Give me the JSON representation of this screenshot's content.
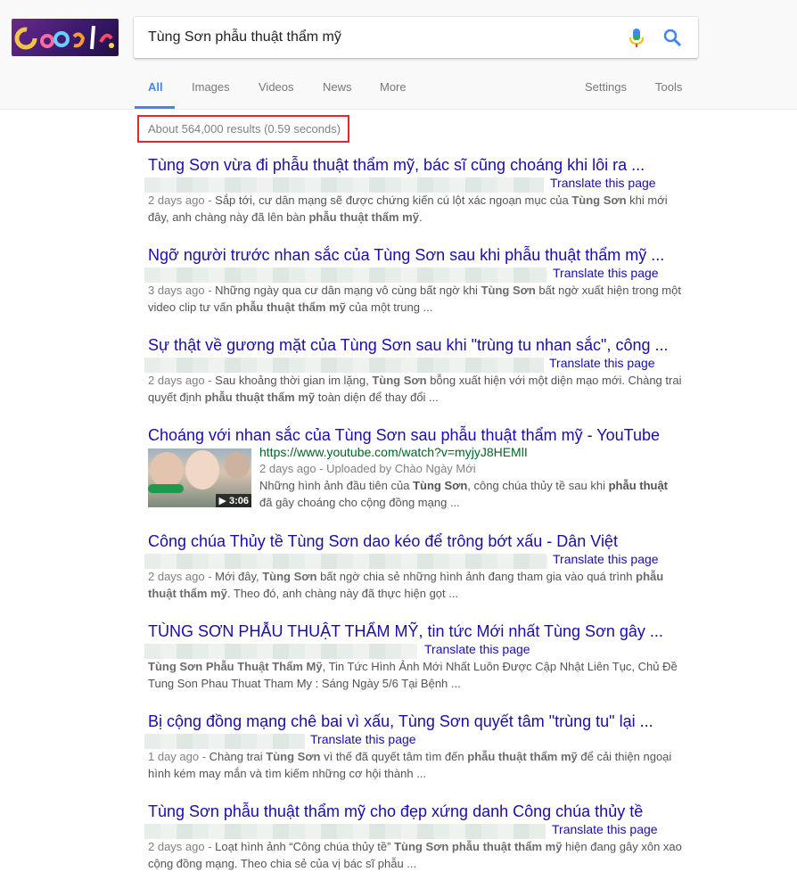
{
  "search": {
    "query": "Tùng Sơn phẫu thuật thẩm mỹ"
  },
  "logo": {
    "alt": "Google doodle logo"
  },
  "tabs": [
    {
      "label": "All",
      "active": true
    },
    {
      "label": "Images"
    },
    {
      "label": "Videos"
    },
    {
      "label": "News"
    },
    {
      "label": "More"
    }
  ],
  "right_tabs": [
    {
      "label": "Settings"
    },
    {
      "label": "Tools"
    }
  ],
  "stats": "About 564,000 results (0.59 seconds)",
  "results": [
    {
      "title": "Tùng Sơn vừa đi phẫu thuật thẩm mỹ, bác sĩ cũng choáng khi lôi ra ...",
      "translate": "Translate this page",
      "date": "2 days ago - ",
      "snippet_html": "Sắp tới, cư dân mạng sẽ được chứng kiến cú lột xác ngoạn mục của <b>Tùng Sơn</b> khi mới đây, anh chàng này đã lên bàn <b>phẫu thuật thẩm mỹ</b>."
    },
    {
      "title": "Ngỡ người trước nhan sắc của Tùng Sơn sau khi phẫu thuật thẩm mỹ ...",
      "translate": "Translate this page",
      "date": "3 days ago - ",
      "snippet_html": "Những ngày qua cư dân mạng vô cùng bất ngờ khi <b>Tùng Sơn</b> bất ngờ xuất hiện trong một video clip tư vấn <b>phẫu thuật thẩm mỹ</b> của một trung ..."
    },
    {
      "title": "Sự thật về gương mặt của Tùng Sơn sau khi \"trùng tu nhan sắc\", công ...",
      "translate": "Translate this page",
      "date": "2 days ago - ",
      "snippet_html": "Sau khoảng thời gian im lặng, <b>Tùng Sơn</b> bỗng xuất hiện với một diện mạo mới. Chàng trai quyết định <b>phẫu thuật thẩm mỹ</b> toàn diện để thay đổi ..."
    },
    {
      "title": "Choáng với nhan sắc của Tùng Sơn sau phẫu thuật thẩm mỹ - YouTube",
      "url": "https://www.youtube.com/watch?v=myjyJ8HEMlI",
      "date": "2 days ago - Uploaded by Chào Ngày Mới",
      "snippet_html": "Những hình ảnh đầu tiên của <b>Tùng Sơn</b>, công chúa thủy tề sau khi <b>phẫu thuật</b> đã gây choáng cho cộng đồng mạng ...",
      "duration": "▶ 3:06"
    },
    {
      "title": "Công chúa Thủy tề Tùng Sơn dao kéo để trông bớt xấu - Dân Việt",
      "translate": "Translate this page",
      "date": "2 days ago - ",
      "snippet_html": "Mới đây, <b>Tùng Sơn</b> bất ngờ chia sẻ những hình ảnh đang tham gia vào quá trình <b>phẫu thuật thẩm mỹ</b>. Theo đó, anh chàng này đã thực hiện gọt ..."
    },
    {
      "title": "TÙNG SƠN PHẪU THUẬT THẨM MỸ, tin tức Mới nhất Tùng Sơn gây ...",
      "translate": "Translate this page",
      "date": "",
      "snippet_html": "<b>Tùng Sơn Phẫu Thuật Thẩm Mỹ</b>, Tin Tức Hình Ảnh Mới Nhất Luôn Được Cập Nhật Liên Tục, Chủ Đề Tung Son Phau Thuat Tham My : Sáng Ngày 5/6 Tại Bệnh ..."
    },
    {
      "title": "Bị cộng đồng mạng chê bai vì xấu, Tùng Sơn quyết tâm \"trùng tu\" lại ...",
      "translate": "Translate this page",
      "date": "1 day ago - ",
      "snippet_html": "Chàng trai <b>Tùng Sơn</b> vì thế đã quyết tâm tìm đến <b>phẫu thuật thẩm mỹ</b> để cải thiện ngoại hình kém may mắn và tìm kiếm những cơ hội thành ..."
    },
    {
      "title": "Tùng Sơn phẫu thuật thẩm mỹ cho đẹp xứng danh Công chúa thủy tề",
      "translate": "Translate this page",
      "date": "2 days ago - ",
      "snippet_html": "Loạt hình ảnh “Công chúa thủy tề” <b>Tùng Sơn phẫu thuật thẩm mỹ</b> hiện đang gây xôn xao cộng đồng mạng. Theo chia sẻ của vị bác sĩ phẫu ..."
    }
  ],
  "colors": {
    "link": "#1a0dab",
    "url_green": "#006621",
    "tab_active": "#4285f4",
    "highlight_box": "#e0282d"
  }
}
